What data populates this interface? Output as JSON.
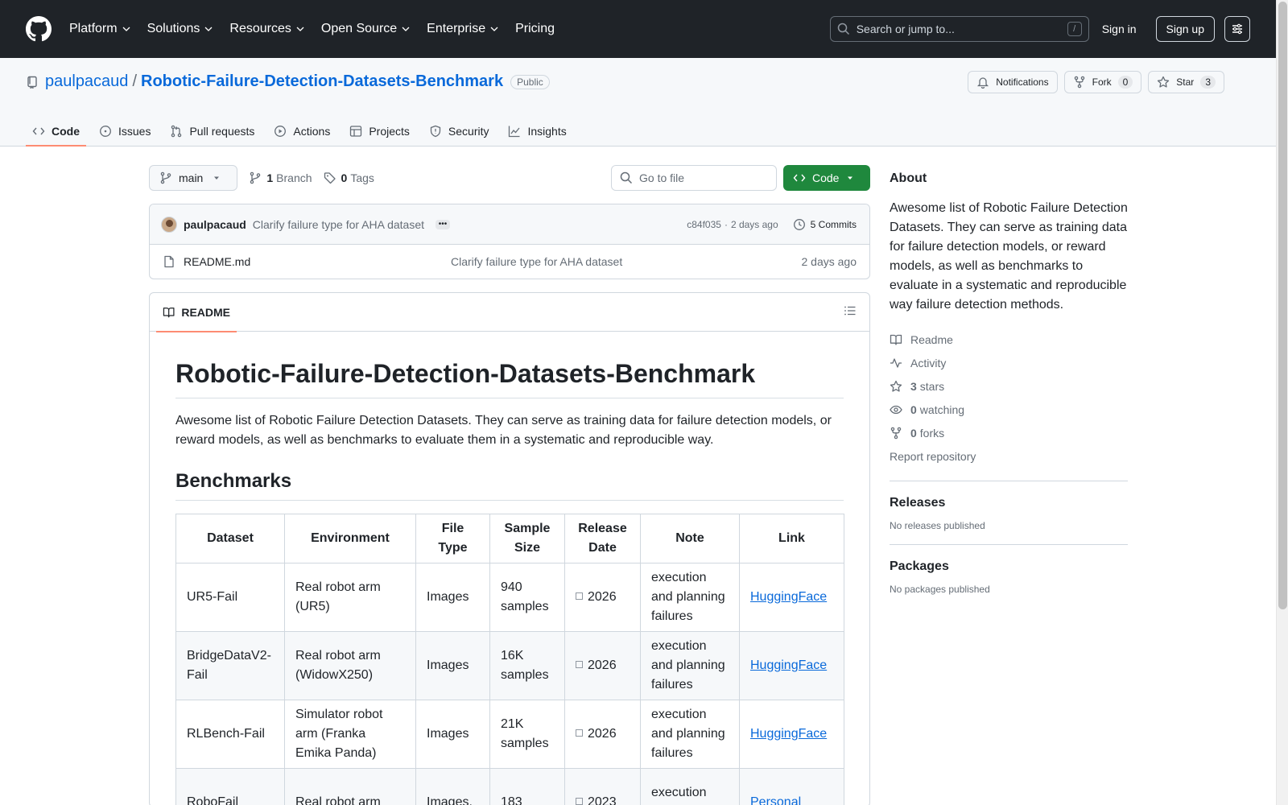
{
  "header": {
    "nav": [
      "Platform",
      "Solutions",
      "Resources",
      "Open Source",
      "Enterprise"
    ],
    "pricing": "Pricing",
    "search_placeholder": "Search or jump to...",
    "search_kbd": "/",
    "sign_in": "Sign in",
    "sign_up": "Sign up"
  },
  "repo": {
    "owner": "paulpacaud",
    "slash": "/",
    "name": "Robotic-Failure-Detection-Datasets-Benchmark",
    "visibility": "Public",
    "notifications": "Notifications",
    "fork": "Fork",
    "fork_count": "0",
    "star": "Star",
    "star_count": "3",
    "tabs": [
      "Code",
      "Issues",
      "Pull requests",
      "Actions",
      "Projects",
      "Security",
      "Insights"
    ]
  },
  "toolbar": {
    "branch": "main",
    "branch_count": "1",
    "branch_label": "Branch",
    "tag_count": "0",
    "tag_label": "Tags",
    "goto_placeholder": "Go to file",
    "code": "Code"
  },
  "commit": {
    "author": "paulpacaud",
    "message": "Clarify failure type for AHA dataset",
    "ellipsis": "•••",
    "sha": "c84f035",
    "sep": "·",
    "when": "2 days ago",
    "commits": "5 Commits"
  },
  "files": [
    {
      "name": "README.md",
      "message": "Clarify failure type for AHA dataset",
      "date": "2 days ago"
    }
  ],
  "readme": {
    "tab": "README",
    "title": "Robotic-Failure-Detection-Datasets-Benchmark",
    "intro": "Awesome list of Robotic Failure Detection Datasets. They can serve as training data for failure detection models, or reward models, as well as benchmarks to evaluate them in a systematic and reproducible way.",
    "section": "Benchmarks",
    "columns": [
      "Dataset",
      "Environment",
      "File Type",
      "Sample Size",
      "Release Date",
      "Note",
      "Link"
    ],
    "rows": [
      {
        "dataset": "UR5-Fail",
        "env": "Real robot arm (UR5)",
        "type": "Images",
        "size": "940 samples",
        "date": "2026",
        "note": "execution and planning failures",
        "link": "HuggingFace"
      },
      {
        "dataset": "BridgeDataV2-Fail",
        "env": "Real robot arm (WidowX250)",
        "type": "Images",
        "size": "16K samples",
        "date": "2026",
        "note": "execution and planning failures",
        "link": "HuggingFace"
      },
      {
        "dataset": "RLBench-Fail",
        "env": "Simulator robot arm (Franka Emika Panda)",
        "type": "Images",
        "size": "21K samples",
        "date": "2026",
        "note": "execution and planning failures",
        "link": "HuggingFace"
      },
      {
        "dataset": "RoboFail",
        "env": "Real robot arm",
        "type": "Images,",
        "size": "183",
        "date": "2023",
        "note": "execution and planning",
        "link": "Personal"
      }
    ]
  },
  "sidebar": {
    "about": "About",
    "description": "Awesome list of Robotic Failure Detection Datasets. They can serve as training data for failure detection models, or reward models, as well as benchmarks to evaluate in a systematic and reproducible way failure detection methods.",
    "readme": "Readme",
    "activity": "Activity",
    "stars_count": "3",
    "stars": "stars",
    "watching_count": "0",
    "watching": "watching",
    "forks_count": "0",
    "forks": "forks",
    "report": "Report repository",
    "releases": "Releases",
    "no_releases": "No releases published",
    "packages": "Packages",
    "no_packages": "No packages published"
  }
}
